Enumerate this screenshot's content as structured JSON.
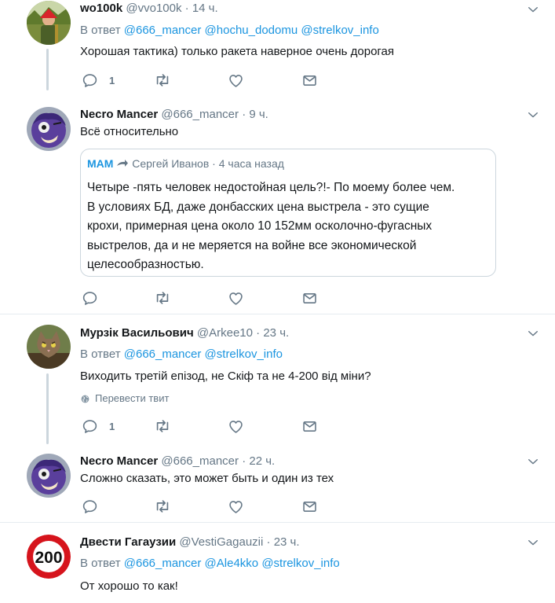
{
  "tweets": [
    {
      "name": "wo100k",
      "handle": "@vvo100k",
      "time": "14 ч.",
      "reply_prefix": "В ответ",
      "mentions": [
        "@666_mancer",
        "@hochu_dodomu",
        "@strelkov_info"
      ],
      "text": "Хорошая тактика) только ракета наверное очень дорогая",
      "reply_count": "1"
    },
    {
      "name": "Necro Mancer",
      "handle": "@666_mancer",
      "time": "9 ч.",
      "text": "Всё относительно",
      "quote": {
        "brand": "MAM",
        "author": "Сергей Иванов",
        "time": "4 часа назад",
        "lines": [
          "Четыре -пять человек недостойная цель?!- По моему более чем.",
          "В условиях БД, даже донбасских цена выстрела - это сущие",
          "крохи, примерная цена около 10 152мм осколочно-фугасных",
          "выстрелов, да и не меряется на войне все экономической",
          "целесообразностью."
        ]
      }
    },
    {
      "name": "Мурзік Васильович",
      "handle": "@Arkee10",
      "time": "23 ч.",
      "reply_prefix": "В ответ",
      "mentions": [
        "@666_mancer",
        "@strelkov_info"
      ],
      "text": "Виходить третій епізод, не Скіф та не 4-200 від міни?",
      "translate": "Перевести твит",
      "reply_count": "1"
    },
    {
      "name": "Necro Mancer",
      "handle": "@666_mancer",
      "time": "22 ч.",
      "text": "Сложно сказать, это может быть и один из тех"
    },
    {
      "name": "Двести Гагаузии",
      "handle": "@VestiGagauzii",
      "time": "23 ч.",
      "reply_prefix": "В ответ",
      "mentions": [
        "@666_mancer",
        "@Ale4kko",
        "@strelkov_info"
      ],
      "text": "От хорошо то как!",
      "avatar_text": "200"
    }
  ],
  "separator_dot": "·",
  "icons": [
    "reply-icon",
    "retweet-icon",
    "like-icon",
    "dm-icon",
    "caret-down-icon",
    "globe-icon"
  ],
  "colors": {
    "link": "#1b95e0",
    "muted": "#657786",
    "text": "#14171a",
    "border": "#e6ecf0"
  }
}
